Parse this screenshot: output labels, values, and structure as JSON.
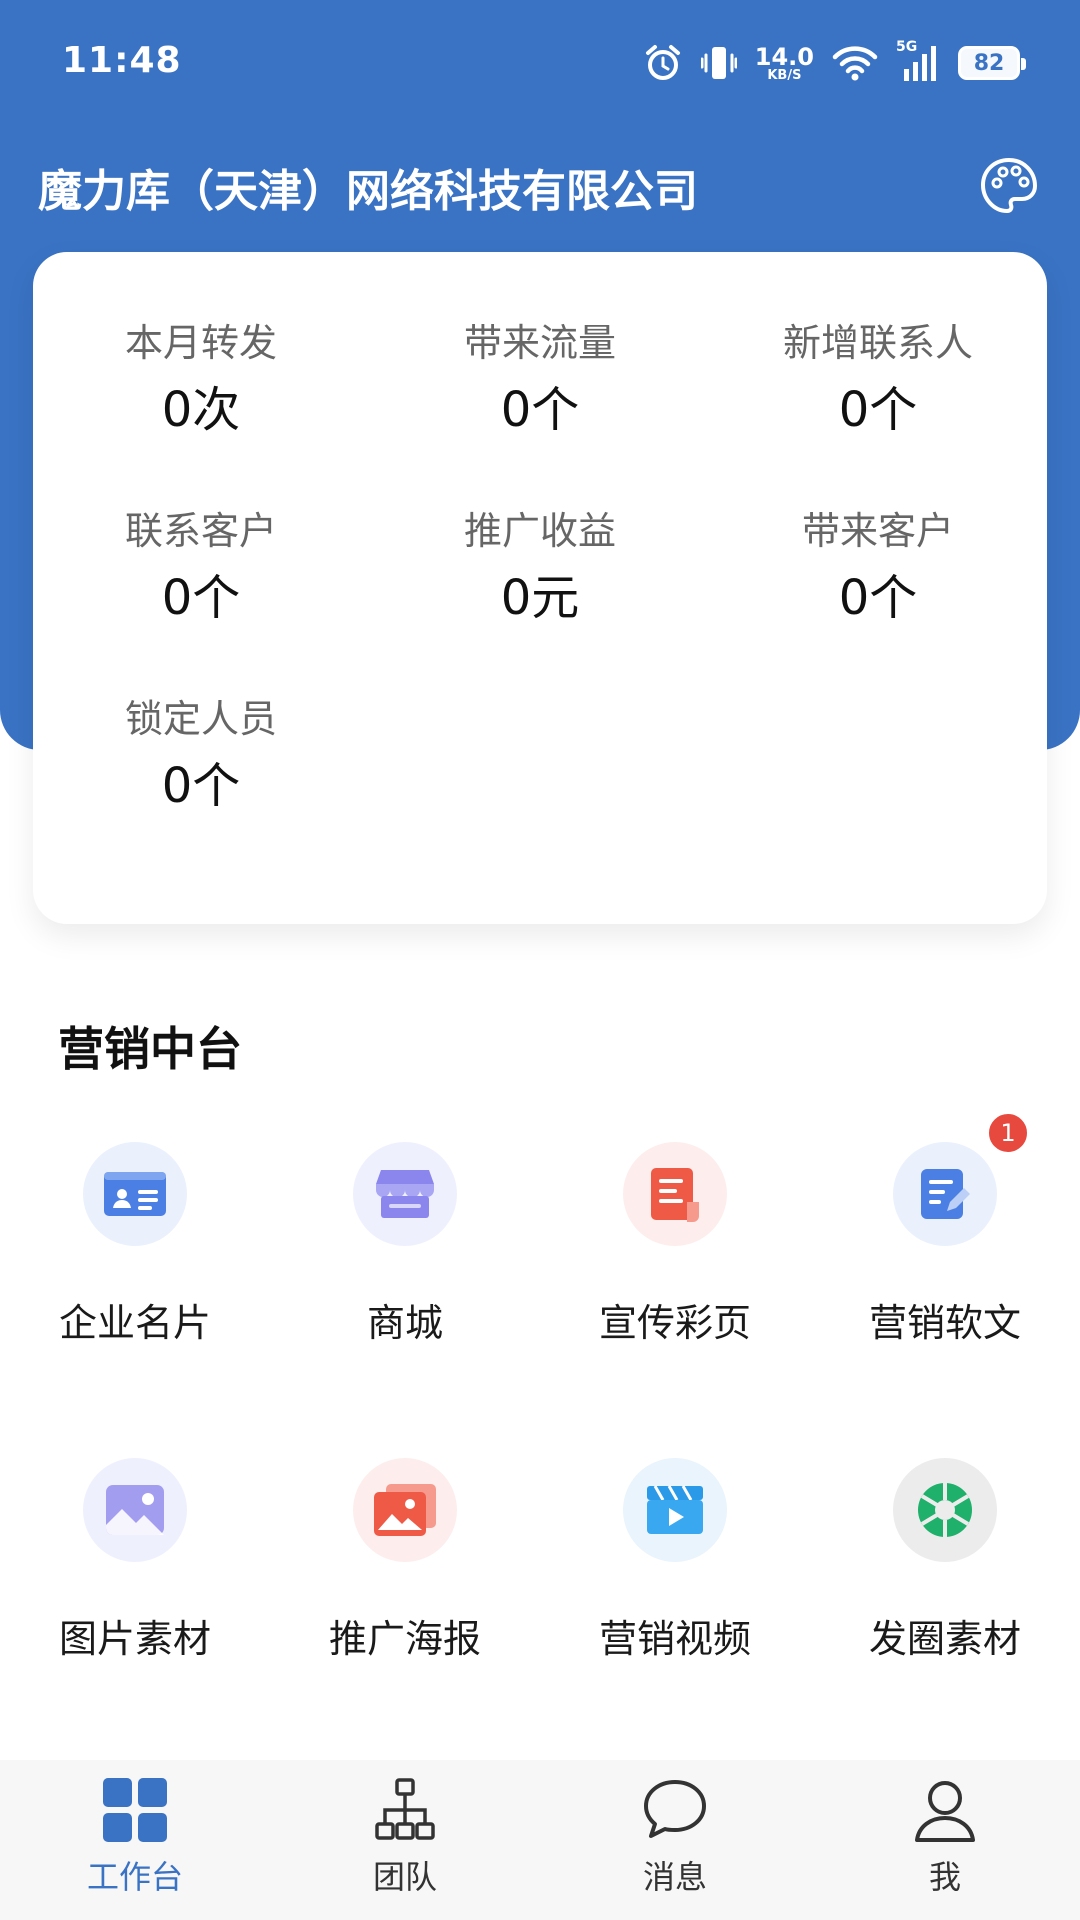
{
  "status_bar": {
    "time": "11:48",
    "net_speed_value": "14.0",
    "net_speed_unit": "KB/S",
    "signal_label": "5G",
    "battery": "82"
  },
  "header": {
    "company_name": "魔力库（天津）网络科技有限公司",
    "theme_icon": "palette-icon"
  },
  "stats": [
    {
      "label": "本月转发",
      "value": "0次"
    },
    {
      "label": "带来流量",
      "value": "0个"
    },
    {
      "label": "新增联系人",
      "value": "0个"
    },
    {
      "label": "联系客户",
      "value": "0个"
    },
    {
      "label": "推广收益",
      "value": "0元"
    },
    {
      "label": "带来客户",
      "value": "0个"
    },
    {
      "label": "锁定人员",
      "value": "0个"
    }
  ],
  "section": {
    "title": "营销中台"
  },
  "tools": [
    {
      "label": "企业名片",
      "icon": "business-card-icon"
    },
    {
      "label": "商城",
      "icon": "shop-icon"
    },
    {
      "label": "宣传彩页",
      "icon": "brochure-icon"
    },
    {
      "label": "营销软文",
      "icon": "article-edit-icon",
      "badge": "1"
    },
    {
      "label": "图片素材",
      "icon": "image-icon"
    },
    {
      "label": "推广海报",
      "icon": "poster-icon"
    },
    {
      "label": "营销视频",
      "icon": "video-icon"
    },
    {
      "label": "发圈素材",
      "icon": "aperture-icon"
    }
  ],
  "nav": [
    {
      "label": "工作台",
      "icon": "grid-icon",
      "active": true
    },
    {
      "label": "团队",
      "icon": "org-chart-icon"
    },
    {
      "label": "消息",
      "icon": "chat-bubble-icon"
    },
    {
      "label": "我",
      "icon": "user-icon"
    }
  ],
  "colors": {
    "primary": "#3a73c4",
    "badge": "#e8493f"
  }
}
